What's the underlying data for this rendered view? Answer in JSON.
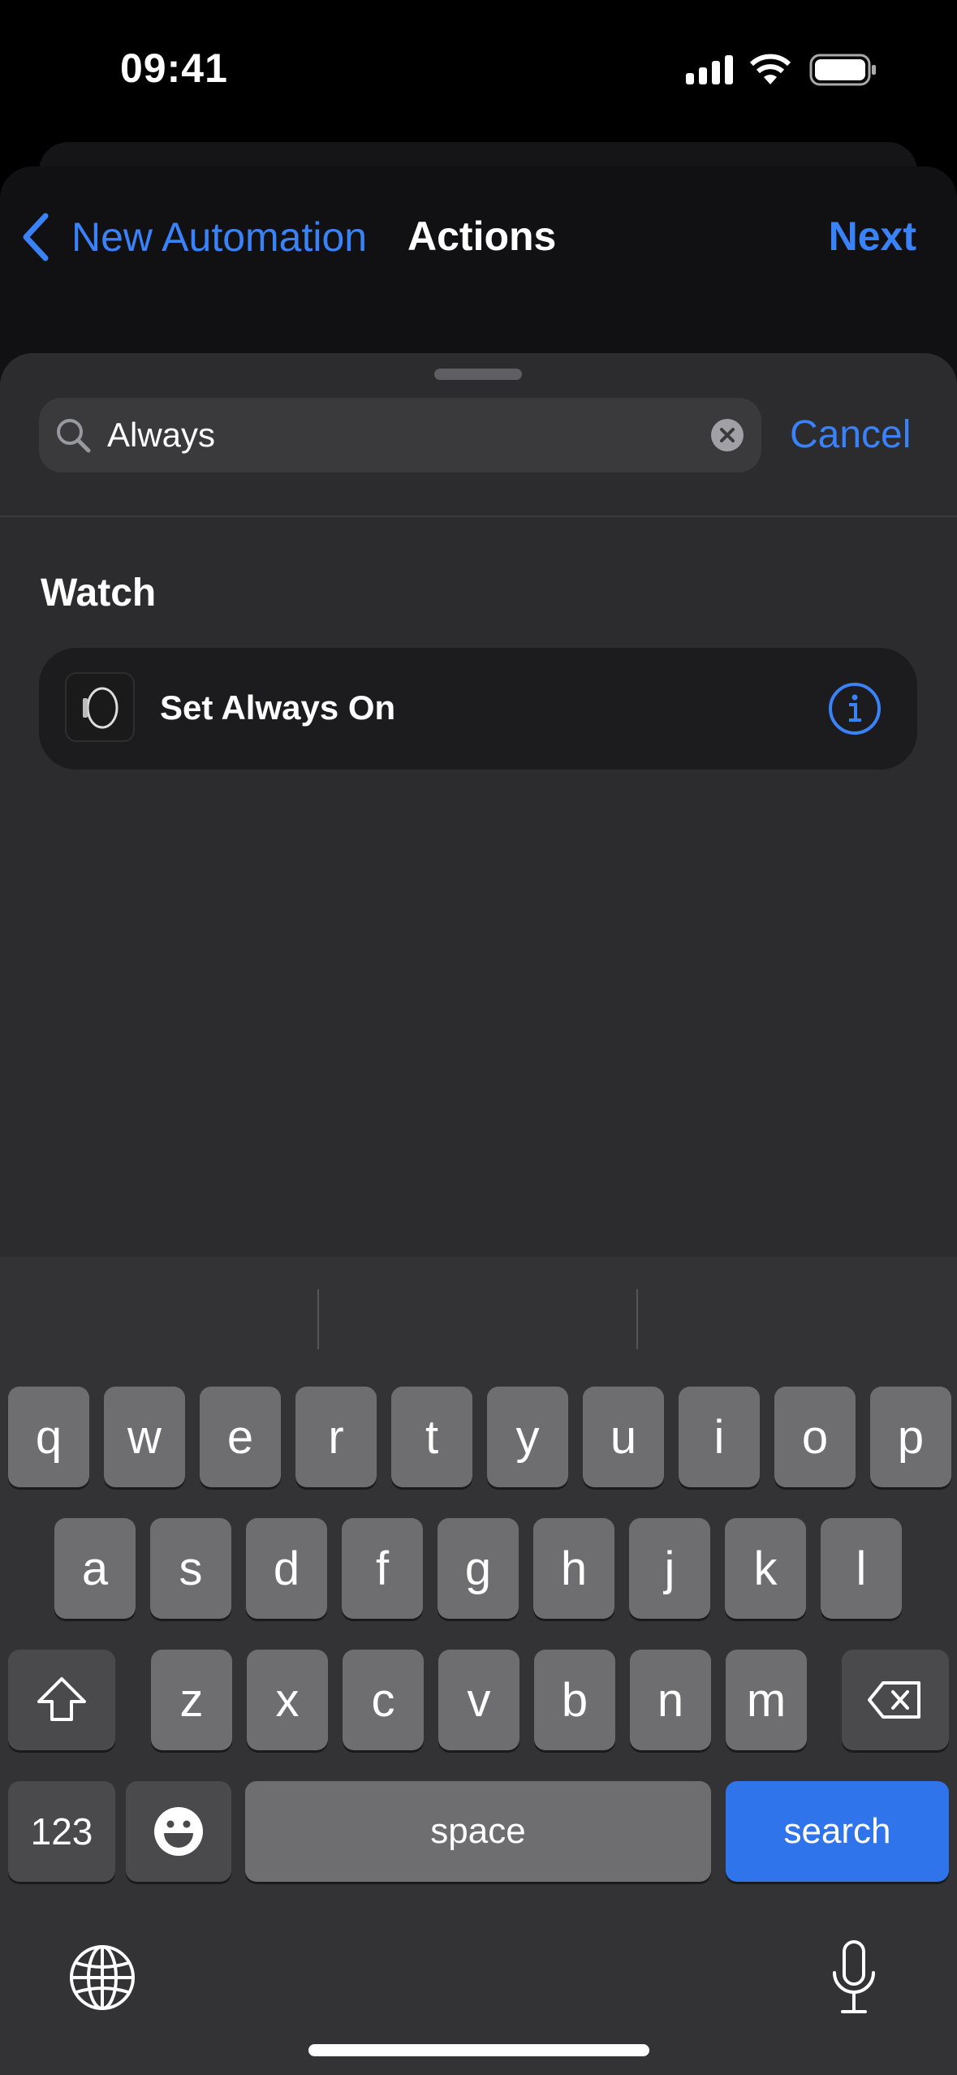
{
  "status_bar": {
    "time": "09:41",
    "icons": [
      "cellular-signal-icon",
      "wifi-icon",
      "battery-icon"
    ]
  },
  "nav": {
    "back_label": "New Automation",
    "title": "Actions",
    "next_label": "Next"
  },
  "search": {
    "value": "Always",
    "cancel_label": "Cancel"
  },
  "results": {
    "section_title": "Watch",
    "items": [
      {
        "label": "Set Always On",
        "icon": "apple-watch-icon"
      }
    ]
  },
  "keyboard": {
    "rows": [
      [
        "q",
        "w",
        "e",
        "r",
        "t",
        "y",
        "u",
        "i",
        "o",
        "p"
      ],
      [
        "a",
        "s",
        "d",
        "f",
        "g",
        "h",
        "j",
        "k",
        "l"
      ],
      [
        "z",
        "x",
        "c",
        "v",
        "b",
        "n",
        "m"
      ]
    ],
    "numbers_label": "123",
    "space_label": "space",
    "search_label": "search"
  },
  "colors": {
    "accent": "#3a82f7",
    "search_key": "#2f74ea"
  }
}
